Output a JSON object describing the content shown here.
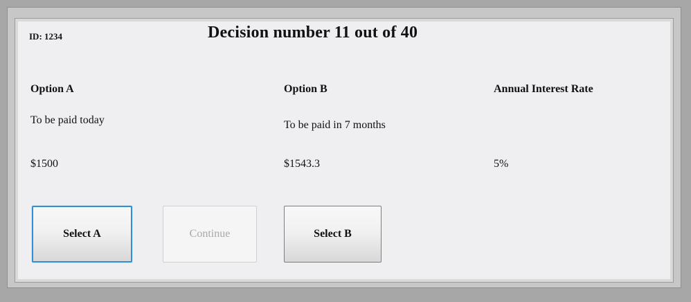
{
  "header": {
    "id_label": "ID: 1234",
    "title": "Decision number 11 out of 40"
  },
  "options": {
    "option_a": {
      "heading": "Option A",
      "timing": "To be paid today",
      "amount": "$1500"
    },
    "option_b": {
      "heading": "Option B",
      "timing": "To be paid in 7 months",
      "amount": "$1543.3"
    },
    "interest": {
      "heading": "Annual Interest Rate",
      "value": "5%"
    }
  },
  "buttons": {
    "select_a": "Select A",
    "continue": "Continue",
    "select_b": "Select B"
  },
  "colors": {
    "selected_border": "#2f8fd7",
    "panel_background": "#efeff1",
    "outer_background": "#a7a7a7"
  }
}
